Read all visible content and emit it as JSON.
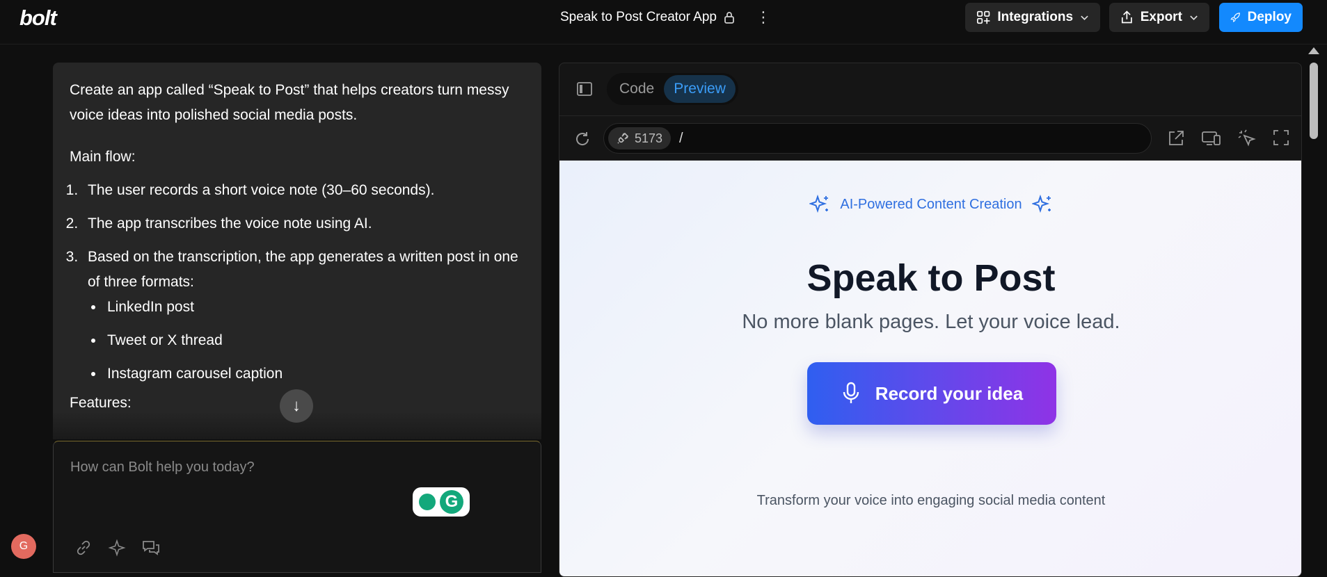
{
  "header": {
    "logo": "bolt",
    "project_title": "Speak to Post Creator App",
    "integrations_label": "Integrations",
    "export_label": "Export",
    "deploy_label": "Deploy"
  },
  "chat": {
    "intro": "Create an app called “Speak to Post” that helps creators turn messy voice ideas into polished social media posts.",
    "main_flow_heading": "Main flow:",
    "steps": [
      "The user records a short voice note (30–60 seconds).",
      "The app transcribes the voice note using AI.",
      "Based on the transcription, the app generates a written post in one of three formats:"
    ],
    "formats": [
      "LinkedIn post",
      "Tweet or X thread",
      "Instagram carousel caption"
    ],
    "features_heading": "Features:"
  },
  "prompt": {
    "placeholder": "How can Bolt help you today?",
    "grammarly_letter": "G"
  },
  "user": {
    "avatar_initial": "G"
  },
  "workbench": {
    "tabs": [
      {
        "label": "Code"
      },
      {
        "label": "Preview"
      }
    ],
    "active_tab": "Preview",
    "port": "5173",
    "path": "/"
  },
  "preview": {
    "badge": "AI-Powered Content Creation",
    "title": "Speak to Post",
    "subtitle": "No more blank pages. Let your voice lead.",
    "record_button": "Record your idea",
    "tagline": "Transform your voice into engaging social media content"
  },
  "colors": {
    "accent_blue": "#1389fd",
    "preview_tab_active": "#3b9df8",
    "record_gradient_start": "#2f5ff0",
    "record_gradient_end": "#8f33e6"
  }
}
